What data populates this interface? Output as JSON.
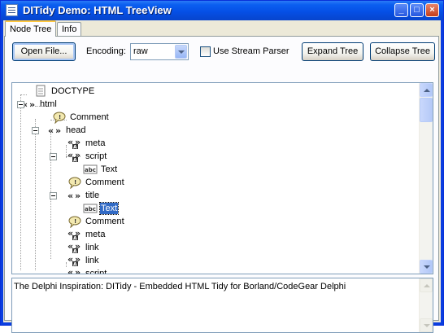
{
  "window": {
    "title": "DITidy Demo: HTML TreeView",
    "minimize_icon": "minimize-icon",
    "maximize_icon": "maximize-icon",
    "close_icon": "close-icon"
  },
  "tabs": [
    {
      "label": "Node Tree",
      "active": true
    },
    {
      "label": "Info",
      "active": false
    }
  ],
  "toolbar": {
    "open_file_label": "Open File...",
    "encoding_label": "Encoding:",
    "encoding_value": "raw",
    "stream_parser_label": "Use Stream Parser",
    "stream_parser_checked": false,
    "expand_label": "Expand Tree",
    "collapse_label": "Collapse Tree"
  },
  "tree": {
    "nodes": [
      {
        "label": "DOCTYPE",
        "icon": "doctype-page-icon"
      },
      {
        "label": "html",
        "icon": "element-tag-icon"
      },
      {
        "label": "Comment",
        "icon": "comment-icon"
      },
      {
        "label": "head",
        "icon": "element-tag-icon"
      },
      {
        "label": "meta",
        "icon": "element-attribute-tag-icon"
      },
      {
        "label": "script",
        "icon": "element-attribute-tag-icon"
      },
      {
        "label": "Text",
        "icon": "text-node-icon"
      },
      {
        "label": "Comment",
        "icon": "comment-icon"
      },
      {
        "label": "title",
        "icon": "element-tag-icon"
      },
      {
        "label": "Text",
        "icon": "text-node-icon",
        "selected": true
      },
      {
        "label": "Comment",
        "icon": "comment-icon"
      },
      {
        "label": "meta",
        "icon": "element-attribute-tag-icon"
      },
      {
        "label": "link",
        "icon": "element-attribute-tag-icon"
      },
      {
        "label": "link",
        "icon": "element-attribute-tag-icon"
      },
      {
        "label": "script",
        "icon": "element-attribute-tag-icon"
      }
    ]
  },
  "info_text": "The Delphi Inspiration: DITidy - Embedded HTML Tidy for Borland/CodeGear Delphi"
}
